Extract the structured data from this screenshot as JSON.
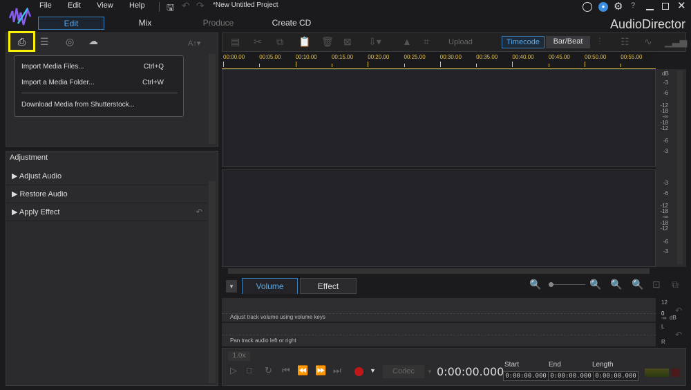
{
  "app": {
    "name": "AudioDirector",
    "project": "*New Untitled Project"
  },
  "menu": [
    "File",
    "Edit",
    "View",
    "Help"
  ],
  "modes": [
    "Edit",
    "Mix",
    "Produce",
    "Create CD"
  ],
  "import_menu": {
    "items": [
      {
        "label": "Import Media Files...",
        "shortcut": "Ctrl+Q"
      },
      {
        "label": "Import a Media Folder...",
        "shortcut": "Ctrl+W"
      },
      {
        "label": "Download Media from Shutterstock..."
      }
    ]
  },
  "library": {
    "font_size_label": "A↑▾"
  },
  "adjustment": {
    "title": "Adjustment",
    "items": [
      "Adjust Audio",
      "Restore Audio",
      "Apply Effect"
    ]
  },
  "toolbar": {
    "upload": "Upload",
    "timecode": "Timecode",
    "barbeat": "Bar/Beat"
  },
  "ruler": [
    "00:00.00",
    "00:05.00",
    "00:10.00",
    "00:15.00",
    "00:20.00",
    "00:25.00",
    "00:30.00",
    "00:35.00",
    "00:40.00",
    "00:45.00",
    "00:50.00",
    "00:55.00"
  ],
  "db_scale": {
    "unit": "dB",
    "labels": [
      "-3",
      "-6",
      "-12",
      "-18",
      "-∞",
      "-18",
      "-12",
      "-6",
      "-3"
    ]
  },
  "bottom_tabs": [
    "Volume",
    "Effect"
  ],
  "volume": {
    "hint": "Adjust track volume using volume keys",
    "scale_top": "12",
    "scale_mid": "0",
    "scale_low": "-∞",
    "unit": "dB"
  },
  "pan": {
    "hint": "Pan track audio left or right",
    "left": "L",
    "right": "R"
  },
  "transport": {
    "speed": "1.0x",
    "codec": "Codec",
    "time": "0:00:00.000",
    "start_label": "Start",
    "end_label": "End",
    "length_label": "Length",
    "start": "0:00:00.000",
    "end": "0:00:00.000",
    "length": "0:00:00.000"
  }
}
